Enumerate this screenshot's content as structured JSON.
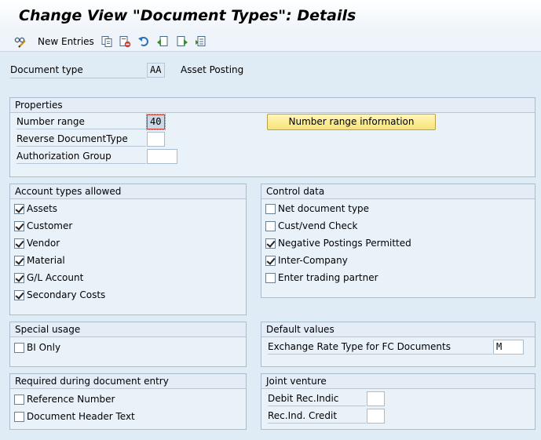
{
  "window": {
    "title": "Change View \"Document Types\": Details"
  },
  "toolbar": {
    "new_entries_label": "New Entries",
    "icons": [
      "glasses-edit-icon",
      "copy-icon",
      "delete-icon",
      "undo-icon",
      "previous-entry-icon",
      "next-entry-icon",
      "select-all-icon"
    ]
  },
  "header": {
    "document_type_label": "Document type",
    "document_type_value": "AA",
    "document_type_text": "Asset Posting"
  },
  "properties": {
    "title": "Properties",
    "number_range_label": "Number range",
    "number_range_value": "40",
    "number_range_info_button": "Number range information",
    "reverse_doc_type_label": "Reverse DocumentType",
    "reverse_doc_type_value": "",
    "authorization_group_label": "Authorization Group",
    "authorization_group_value": ""
  },
  "account_types": {
    "title": "Account types allowed",
    "items": [
      {
        "label": "Assets",
        "checked": true
      },
      {
        "label": "Customer",
        "checked": true
      },
      {
        "label": "Vendor",
        "checked": true
      },
      {
        "label": "Material",
        "checked": true
      },
      {
        "label": "G/L Account",
        "checked": true
      },
      {
        "label": "Secondary Costs",
        "checked": true
      }
    ]
  },
  "control_data": {
    "title": "Control data",
    "items": [
      {
        "label": "Net document type",
        "checked": false
      },
      {
        "label": "Cust/vend Check",
        "checked": false
      },
      {
        "label": "Negative Postings Permitted",
        "checked": true
      },
      {
        "label": "Inter-Company",
        "checked": true
      },
      {
        "label": "Enter trading partner",
        "checked": false
      }
    ]
  },
  "special_usage": {
    "title": "Special usage",
    "items": [
      {
        "label": "BI Only",
        "checked": false
      }
    ]
  },
  "default_values": {
    "title": "Default values",
    "exchange_rate_label": "Exchange Rate Type for FC Documents",
    "exchange_rate_value": "M"
  },
  "required_entry": {
    "title": "Required during document entry",
    "items": [
      {
        "label": "Reference Number",
        "checked": false
      },
      {
        "label": "Document Header Text",
        "checked": false
      }
    ]
  },
  "joint_venture": {
    "title": "Joint venture",
    "debit_label": "Debit Rec.Indic",
    "debit_value": "",
    "credit_label": "Rec.Ind. Credit",
    "credit_value": ""
  }
}
